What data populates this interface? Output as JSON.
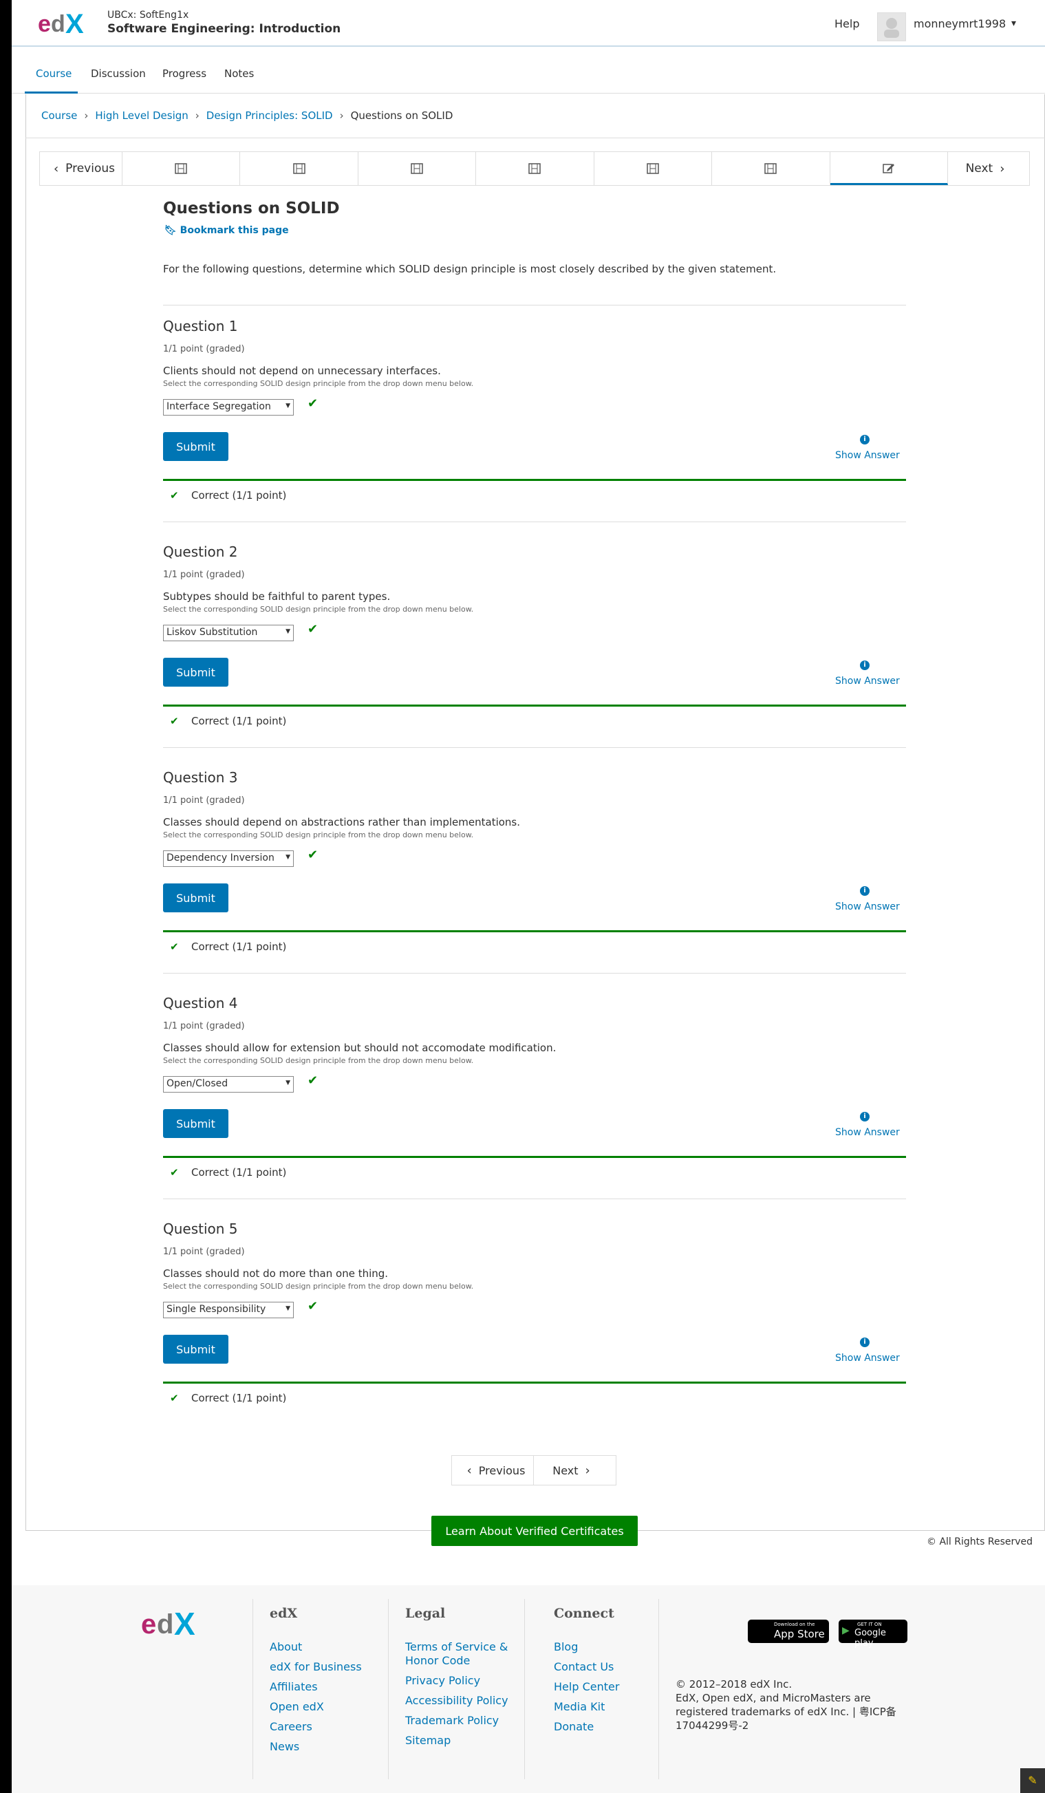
{
  "header": {
    "course_org": "UBCx: SoftEng1x",
    "course_title": "Software Engineering: Introduction",
    "help": "Help",
    "username": "monneymrt1998",
    "user_caret": "▾"
  },
  "tabs": [
    {
      "label": "Course"
    },
    {
      "label": "Discussion"
    },
    {
      "label": "Progress"
    },
    {
      "label": "Notes"
    }
  ],
  "breadcrumb": {
    "items": [
      "Course",
      "High Level Design",
      "Design Principles: SOLID"
    ],
    "current": "Questions on SOLID"
  },
  "sequence_nav": {
    "previous": "Previous",
    "next": "Next",
    "units": [
      "video-icon",
      "video-icon",
      "video-icon",
      "video-icon",
      "video-icon",
      "video-icon",
      "problem-icon"
    ]
  },
  "unit": {
    "title": "Questions on SOLID",
    "bookmark": "Bookmark this page",
    "intro": "For the following questions, determine which SOLID design principle is most closely described by the given statement."
  },
  "questions": [
    {
      "title": "Question 1",
      "points": "1/1 point (graded)",
      "statement": "Clients should not depend on unnecessary interfaces.",
      "help": "Select the corresponding SOLID design principle from the drop down menu below.",
      "selected": "Interface Segregation",
      "submit": "Submit",
      "show_answer": "Show Answer",
      "result": "Correct (1/1 point)"
    },
    {
      "title": "Question 2",
      "points": "1/1 point (graded)",
      "statement": "Subtypes should be faithful to parent types.",
      "help": "Select the corresponding SOLID design principle from the drop down menu below.",
      "selected": "Liskov Substitution",
      "submit": "Submit",
      "show_answer": "Show Answer",
      "result": "Correct (1/1 point)"
    },
    {
      "title": "Question 3",
      "points": "1/1 point (graded)",
      "statement": "Classes should depend on abstractions rather than implementations.",
      "help": "Select the corresponding SOLID design principle from the drop down menu below.",
      "selected": "Dependency Inversion",
      "submit": "Submit",
      "show_answer": "Show Answer",
      "result": "Correct (1/1 point)"
    },
    {
      "title": "Question 4",
      "points": "1/1 point (graded)",
      "statement": "Classes should allow for extension but should not accomodate modification.",
      "help": "Select the corresponding SOLID design principle from the drop down menu below.",
      "selected": "Open/Closed",
      "submit": "Submit",
      "show_answer": "Show Answer",
      "result": "Correct (1/1 point)"
    },
    {
      "title": "Question 5",
      "points": "1/1 point (graded)",
      "statement": "Classes should not do more than one thing.",
      "help": "Select the corresponding SOLID design principle from the drop down menu below.",
      "selected": "Single Responsibility",
      "submit": "Submit",
      "show_answer": "Show Answer",
      "result": "Correct (1/1 point)"
    }
  ],
  "bottom_nav": {
    "previous": "Previous",
    "next": "Next"
  },
  "verified_button": "Learn About Verified Certificates",
  "rights": "© All Rights Reserved",
  "footer": {
    "logo_text": "edX",
    "columns": [
      {
        "heading": "edX",
        "links": [
          "About",
          "edX for Business",
          "Affiliates",
          "Open edX",
          "Careers",
          "News"
        ]
      },
      {
        "heading": "Legal",
        "links": [
          "Terms of Service & Honor Code",
          "Privacy Policy",
          "Accessibility Policy",
          "Trademark Policy",
          "Sitemap"
        ]
      },
      {
        "heading": "Connect",
        "links": [
          "Blog",
          "Contact Us",
          "Help Center",
          "Media Kit",
          "Donate"
        ]
      }
    ],
    "app_store": {
      "small": "Download on the",
      "big": "App Store"
    },
    "google_play": {
      "small": "GET IT ON",
      "big": "Google play"
    },
    "copyright_1": "© 2012–2018 edX Inc.",
    "copyright_2": "EdX, Open edX, and MicroMasters are registered trademarks of edX Inc. | 粤ICP备17044299号-2"
  },
  "colors": {
    "brand_blue": "#0075b4",
    "success_green": "#008100",
    "edx_magenta": "#b5266e",
    "edx_gray": "#767676",
    "edx_cyan": "#00a4d8"
  }
}
